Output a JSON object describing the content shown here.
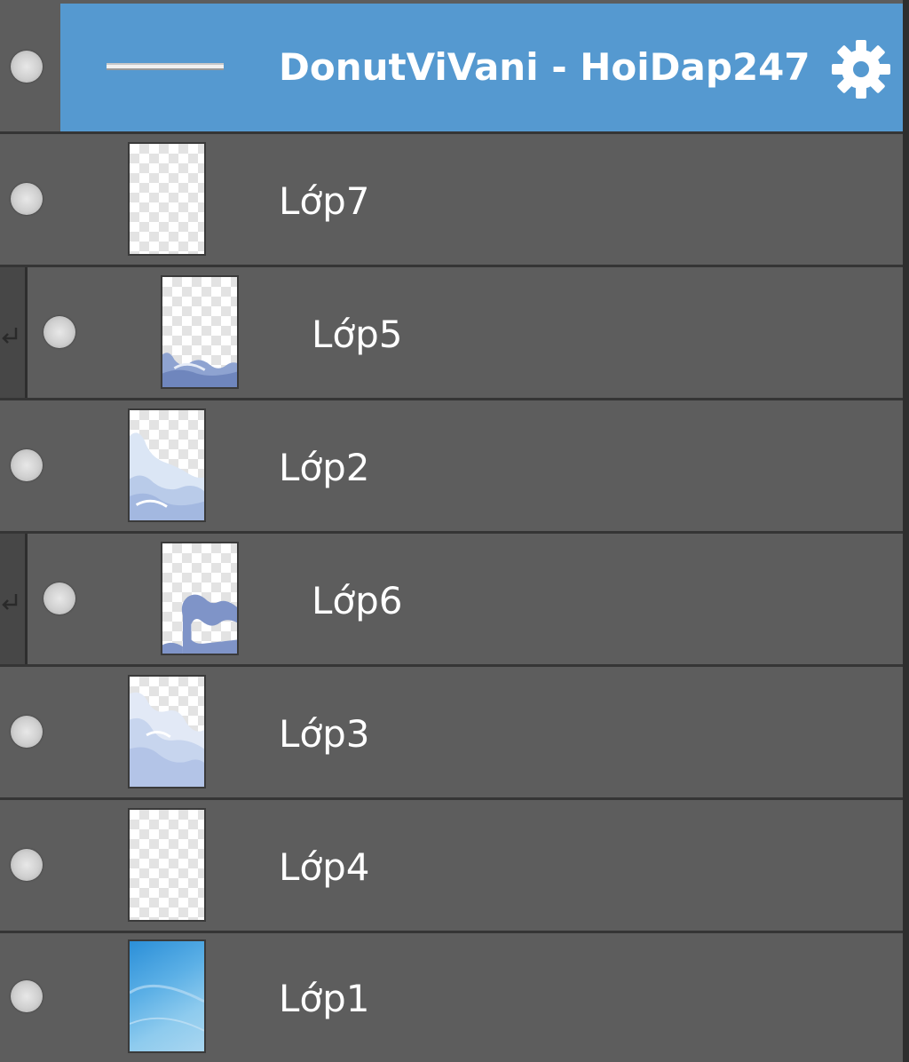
{
  "layers_panel": {
    "group": {
      "name": "DonutViVani - HoiDap247",
      "selected": true,
      "settings_icon": "gear-icon",
      "visible": true
    },
    "layers": [
      {
        "name": "Lớp7",
        "clipped": false,
        "thumbnail": "transparent",
        "visible": true
      },
      {
        "name": "Lớp5",
        "clipped": true,
        "thumbnail": "blue-cloud-bottom",
        "visible": true
      },
      {
        "name": "Lớp2",
        "clipped": false,
        "thumbnail": "light-cloud",
        "visible": true
      },
      {
        "name": "Lớp6",
        "clipped": true,
        "thumbnail": "blue-cloud-outline",
        "visible": true
      },
      {
        "name": "Lớp3",
        "clipped": false,
        "thumbnail": "pale-cloud",
        "visible": true
      },
      {
        "name": "Lớp4",
        "clipped": false,
        "thumbnail": "transparent",
        "visible": true
      },
      {
        "name": "Lớp1",
        "clipped": false,
        "thumbnail": "sky-gradient",
        "visible": true
      }
    ],
    "colors": {
      "row_background": "#5d5d5d",
      "selected_background": "#5599d0",
      "text": "#ffffff",
      "separator": "#353535"
    }
  }
}
